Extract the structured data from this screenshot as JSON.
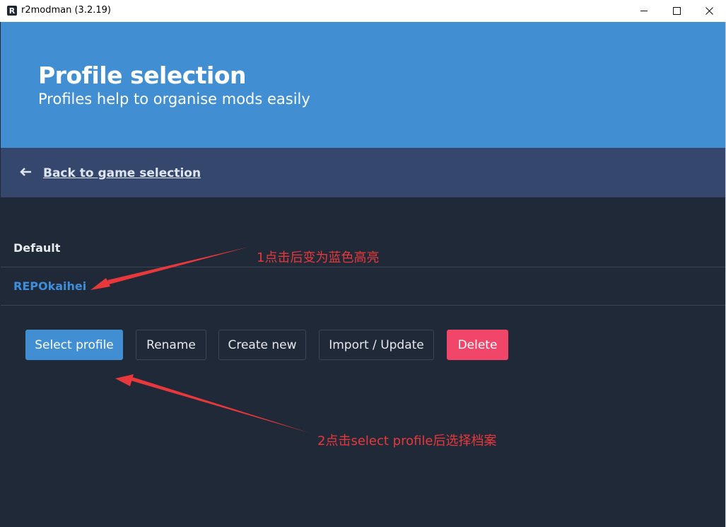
{
  "window": {
    "app_icon_letter": "R",
    "title": "r2modman (3.2.19)",
    "minimize_icon": "minimize-icon",
    "maximize_icon": "maximize-icon",
    "close_icon": "close-icon"
  },
  "hero": {
    "title": "Profile selection",
    "subtitle": "Profiles help to organise mods easily",
    "background_color": "#418fd2"
  },
  "nav": {
    "back_icon": "arrow-left-icon",
    "back_label": "Back to game selection",
    "background_color": "#36476d"
  },
  "profiles": [
    {
      "name": "Default",
      "selected": false
    },
    {
      "name": "REPOkaihei",
      "selected": true
    }
  ],
  "actions": {
    "select_label": "Select profile",
    "rename_label": "Rename",
    "create_label": "Create new",
    "import_label": "Import / Update",
    "delete_label": "Delete",
    "primary_color": "#418fd2",
    "danger_color": "#f1456a"
  },
  "annotations": {
    "note_1": "1点击后变为蓝色高亮",
    "note_2": "2点击select profile后选择档案",
    "color": "#e8383b"
  }
}
